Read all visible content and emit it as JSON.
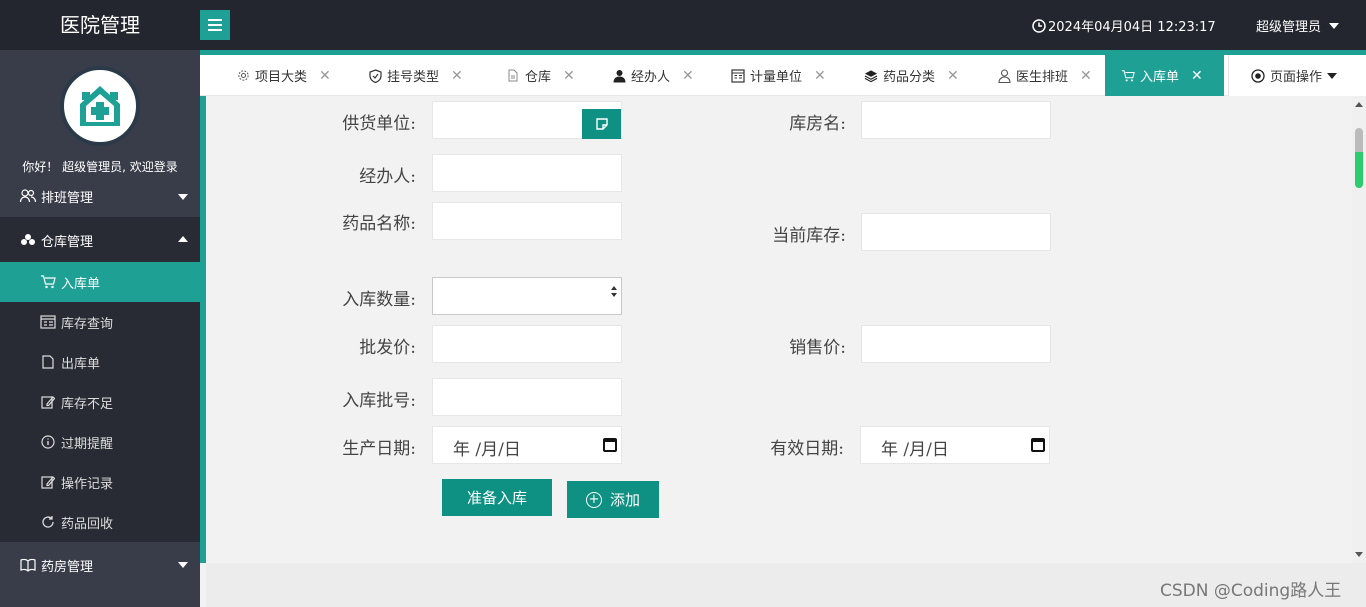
{
  "app": {
    "title": "医院管理"
  },
  "header": {
    "datetime": "2024年04月04日 12:23:17",
    "user": "超级管理员"
  },
  "sidebar": {
    "welcome": "你好！ 超级管理员, 欢迎登录",
    "groups": [
      {
        "label": "排班管理",
        "icon": "users-icon",
        "expanded": false
      },
      {
        "label": "仓库管理",
        "icon": "warehouse-icon",
        "expanded": true
      },
      {
        "label": "药房管理",
        "icon": "book-icon",
        "expanded": false
      }
    ],
    "items": [
      {
        "label": "入库单",
        "icon": "cart-icon",
        "active": true
      },
      {
        "label": "库存查询",
        "icon": "calendar-icon",
        "active": false
      },
      {
        "label": "出库单",
        "icon": "file-icon",
        "active": false
      },
      {
        "label": "库存不足",
        "icon": "edit-icon",
        "active": false
      },
      {
        "label": "过期提醒",
        "icon": "info-icon",
        "active": false
      },
      {
        "label": "操作记录",
        "icon": "edit-icon",
        "active": false
      },
      {
        "label": "药品回收",
        "icon": "refresh-icon",
        "active": false
      }
    ]
  },
  "tabs": [
    {
      "label": "项目大类",
      "icon": "gear-icon"
    },
    {
      "label": "挂号类型",
      "icon": "shield-icon"
    },
    {
      "label": "仓库",
      "icon": "file-icon"
    },
    {
      "label": "经办人",
      "icon": "user-icon"
    },
    {
      "label": "计量单位",
      "icon": "calendar-icon"
    },
    {
      "label": "药品分类",
      "icon": "layers-icon"
    },
    {
      "label": "医生排班",
      "icon": "person-icon"
    },
    {
      "label": "入库单",
      "icon": "cart-icon",
      "active": true
    }
  ],
  "page_ops": {
    "label": "页面操作"
  },
  "form": {
    "supplier": {
      "label": "供货单位:",
      "value": ""
    },
    "warehouse": {
      "label": "库房名:",
      "value": ""
    },
    "handler": {
      "label": "经办人:",
      "value": ""
    },
    "drug_name": {
      "label": "药品名称:",
      "value": ""
    },
    "stock": {
      "label": "当前库存:",
      "value": ""
    },
    "quantity": {
      "label": "入库数量:",
      "value": ""
    },
    "wholesale": {
      "label": "批发价:",
      "value": ""
    },
    "retail": {
      "label": "销售价:",
      "value": ""
    },
    "batch": {
      "label": "入库批号:",
      "value": ""
    },
    "prod_date": {
      "label": "生产日期:",
      "placeholder": "年 /月/日"
    },
    "exp_date": {
      "label": "有效日期:",
      "placeholder": "年 /月/日"
    }
  },
  "buttons": {
    "prepare": "准备入库",
    "add": "添加"
  },
  "watermark": "CSDN @Coding路人王",
  "colors": {
    "accent": "#1fa095",
    "button": "#0e9082",
    "header": "#23262e",
    "sidebar": "#393d49"
  }
}
